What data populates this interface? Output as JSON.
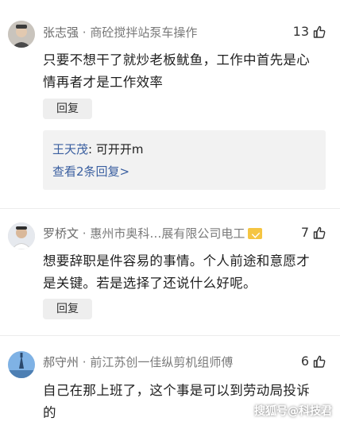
{
  "comments": [
    {
      "name": "张志强",
      "separator": " · ",
      "title": "商砼搅拌站泵车操作",
      "likes": "13",
      "text": "只要不想干了就炒老板鱿鱼，工作中首先是心情再者才是工作效率",
      "reply_label": "回复",
      "nested_reply_name": "王天茂",
      "nested_reply_text": ": 可开开m",
      "view_more": "查看2条回复>"
    },
    {
      "name": "罗桥文",
      "separator": " · ",
      "title": "惠州市奥科…展有限公司电工",
      "likes": "7",
      "text": "想要辞职是件容易的事情。个人前途和意愿才是关键。若是选择了还说什么好呢。",
      "reply_label": "回复"
    },
    {
      "name": "郝守州",
      "separator": " · ",
      "title": "前江苏创一佳纵剪机组师傅",
      "likes": "6",
      "text": "自己在那上班了，这个事是可以到劳动局投诉的"
    }
  ],
  "watermark": "搜狐号@科技君",
  "colors": {
    "link": "#3a5fa0",
    "badge": "#f5c542"
  }
}
